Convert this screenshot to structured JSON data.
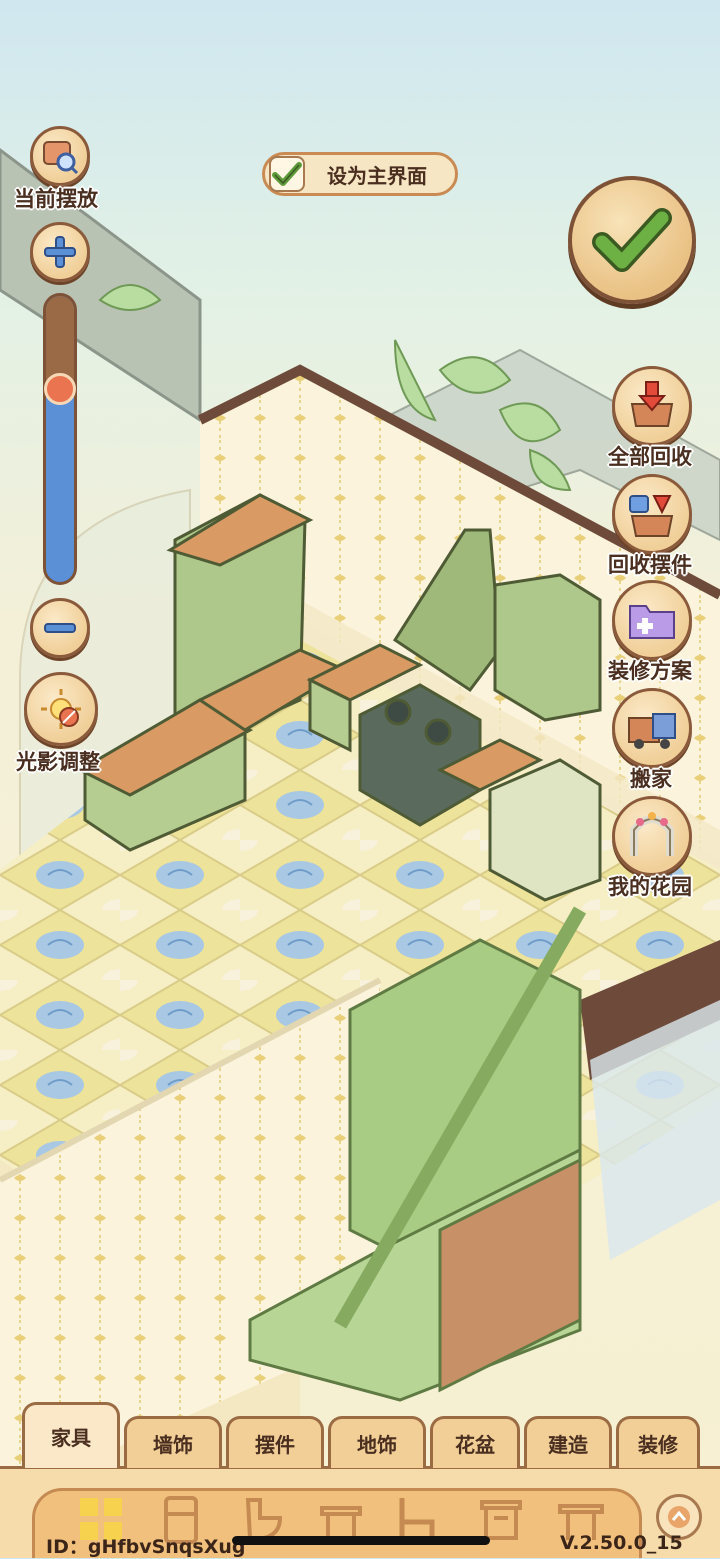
{
  "left_panel": {
    "current_layout_label": "当前摆放",
    "lighting_label": "光影调整",
    "zoom_level": 0.33
  },
  "set_main": {
    "label": "设为主界面",
    "checked": true
  },
  "right_panel": {
    "recycle_all_label": "全部回收",
    "recycle_decor_label": "回收摆件",
    "renovation_plan_label": "装修方案",
    "move_house_label": "搬家",
    "my_garden_label": "我的花园"
  },
  "tabs": [
    {
      "label": "家具",
      "active": true
    },
    {
      "label": "墙饰",
      "active": false
    },
    {
      "label": "摆件",
      "active": false
    },
    {
      "label": "地饰",
      "active": false
    },
    {
      "label": "花盆",
      "active": false
    },
    {
      "label": "建造",
      "active": false
    },
    {
      "label": "装修",
      "active": false
    }
  ],
  "footer": {
    "id_text": "ID：gHfbvSnqsXug",
    "version_text": "V.2.50.0_15"
  },
  "colors": {
    "accent_brown": "#8a5a3b",
    "check_green": "#5f9a3a",
    "slider_blue": "#5b8fd6",
    "slider_knob": "#e9744f"
  }
}
